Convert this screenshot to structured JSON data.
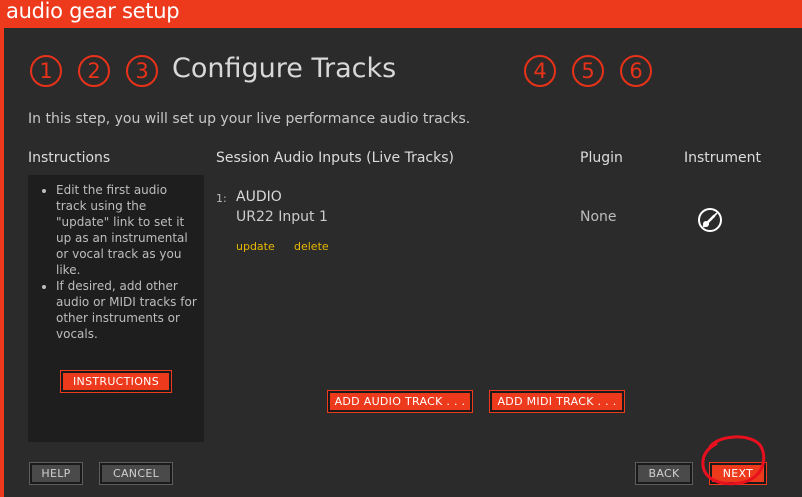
{
  "window": {
    "title": "audio gear setup"
  },
  "steps": {
    "before": [
      "1",
      "2",
      "3"
    ],
    "after": [
      "4",
      "5",
      "6"
    ],
    "current_title": "Configure Tracks"
  },
  "intro": "In this step, you will set up your live performance audio tracks.",
  "instructions": {
    "heading": "Instructions",
    "items": [
      "Edit the first audio track using the \"update\" link to set it up as an instrumental or vocal track as you like.",
      "If desired, add other audio or MIDI tracks for other instruments or vocals."
    ],
    "button_label": "INSTRUCTIONS"
  },
  "table": {
    "headers": {
      "inputs": "Session Audio Inputs (Live Tracks)",
      "plugin": "Plugin",
      "instrument": "Instrument"
    },
    "tracks": [
      {
        "number": "1:",
        "type": "AUDIO",
        "input": "UR22 Input 1",
        "update_label": "update",
        "delete_label": "delete",
        "plugin": "None",
        "instrument_icon": "guitar-icon"
      }
    ]
  },
  "actions": {
    "add_audio_track": "ADD AUDIO TRACK . . .",
    "add_midi_track": "ADD MIDI TRACK . . ."
  },
  "footer": {
    "help": "HELP",
    "cancel": "CANCEL",
    "back": "BACK",
    "next": "NEXT"
  },
  "colors": {
    "accent": "#ee3a1c",
    "background": "#2b2b2b",
    "panel": "#1e1e1e",
    "link": "#e8b800",
    "annotation": "#e8101e"
  }
}
